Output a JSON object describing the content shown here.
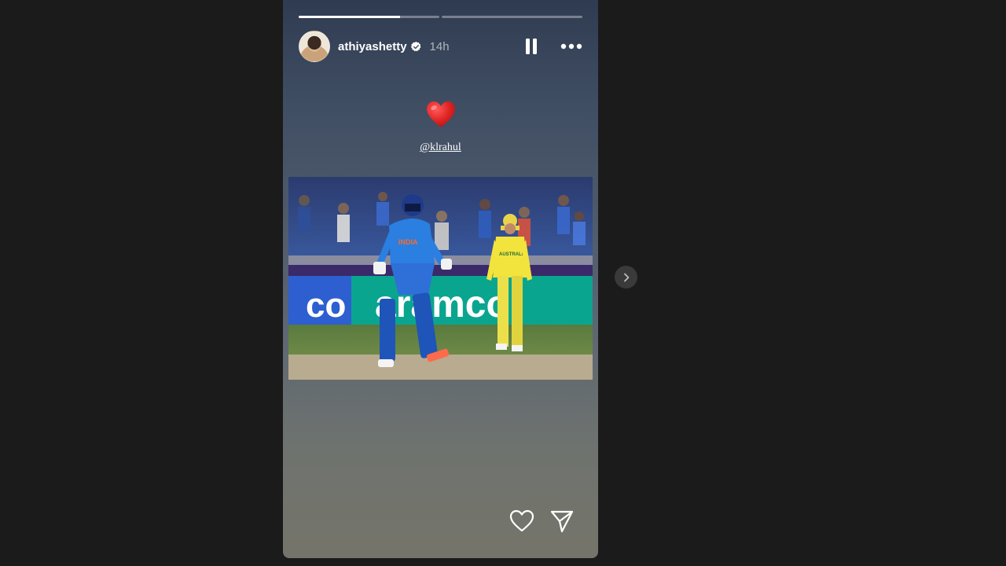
{
  "story": {
    "username": "athiyashetty",
    "time": "14h",
    "mention": "@klrahul",
    "segments": [
      0.72,
      0
    ],
    "emoji": "heart-emoji",
    "photo": {
      "left_banner": "co",
      "right_banner": "aramco",
      "jersey_text": "INDIA",
      "fielder_text": "AUSTRALIA"
    }
  },
  "colors": {
    "page_bg": "#1b1b1b",
    "verified": "#ffffff",
    "heart": "#e02424"
  },
  "icons": [
    "verified-badge-icon",
    "pause-icon",
    "more-icon",
    "heart-emoji",
    "like-icon",
    "share-icon",
    "chevron-right-icon"
  ]
}
